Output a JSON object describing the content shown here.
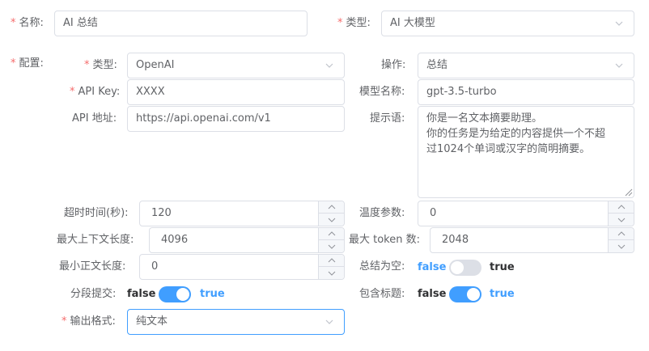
{
  "form": {
    "name": {
      "label": "名称:",
      "value": "AI 总结"
    },
    "type": {
      "label": "类型:",
      "value": "AI 大模型"
    },
    "config_label": "配置:",
    "config": {
      "provider": {
        "label": "类型:",
        "value": "OpenAI"
      },
      "operation": {
        "label": "操作:",
        "value": "总结"
      },
      "api_key": {
        "label": "API Key:",
        "value": "XXXX"
      },
      "model": {
        "label": "模型名称:",
        "value": "gpt-3.5-turbo"
      },
      "api_url": {
        "label": "API 地址:",
        "value": "https://api.openai.com/v1"
      },
      "prompt": {
        "label": "提示语:",
        "lines": [
          "你是一名文本摘要助理。",
          "你的任务是为给定的内容提供一个不超",
          "过1024个单词或汉字的简明摘要。"
        ]
      }
    },
    "timeout": {
      "label": "超时时间(秒):",
      "value": "120"
    },
    "temperature": {
      "label": "温度参数:",
      "value": "0"
    },
    "max_context": {
      "label": "最大上下文长度:",
      "value": "4096"
    },
    "max_tokens": {
      "label": "最大 token 数:",
      "value": "2048"
    },
    "min_content": {
      "label": "最小正文长度:",
      "value": "0"
    },
    "empty_summary": {
      "label": "总结为空:",
      "false_text": "false",
      "true_text": "true",
      "value": false
    },
    "segment_submit": {
      "label": "分段提交:",
      "false_text": "false",
      "true_text": "true",
      "value": true
    },
    "include_title": {
      "label": "包含标题:",
      "false_text": "false",
      "true_text": "true",
      "value": true
    },
    "output_format": {
      "label": "输出格式:",
      "value": "纯文本"
    }
  },
  "colors": {
    "primary": "#409eff",
    "required": "#f56c6c",
    "border": "#dcdfe6",
    "switch_off": "#dcdfe6"
  }
}
